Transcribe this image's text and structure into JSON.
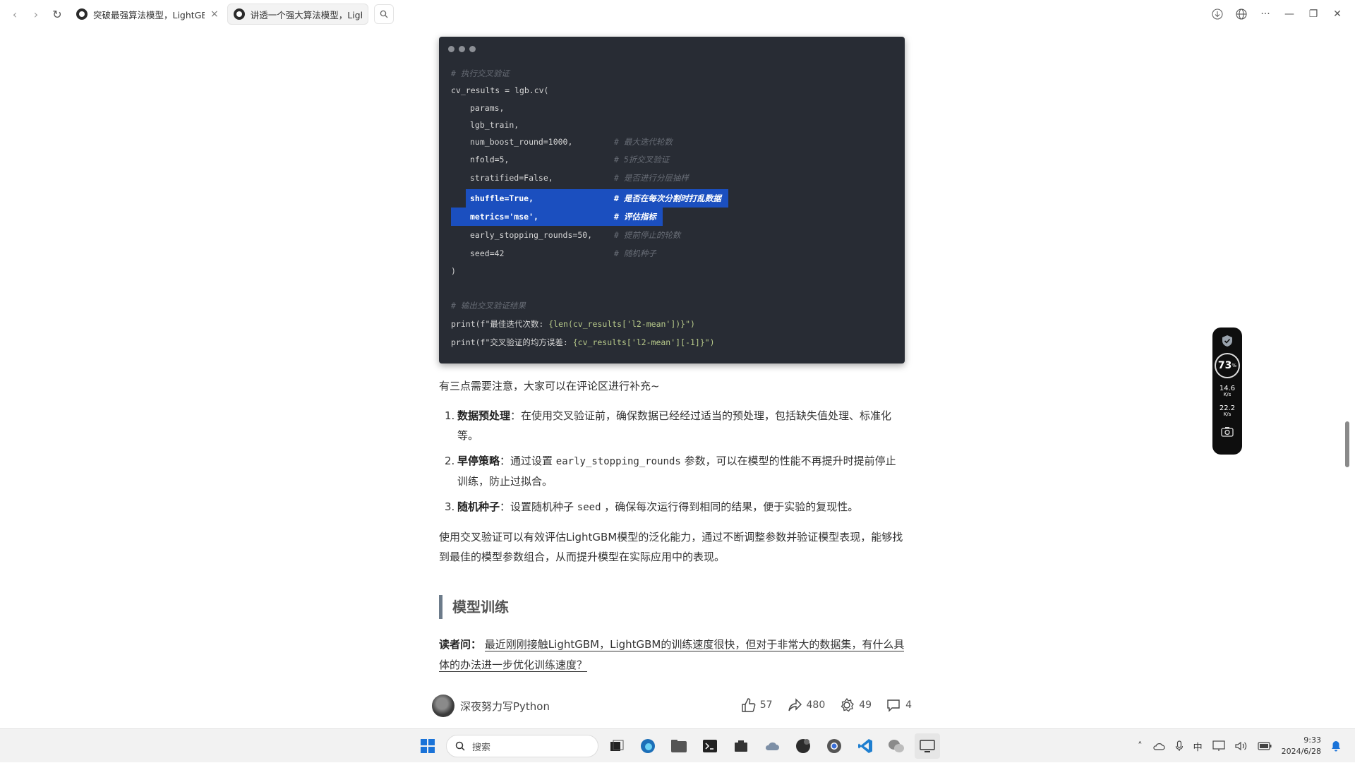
{
  "browser": {
    "tabs": [
      {
        "title": "突破最强算法模型，LightGBM",
        "active": false
      },
      {
        "title": "讲透一个强大算法模型，LightGBM",
        "active": true
      }
    ]
  },
  "code": {
    "comment_cv": "# 执行交叉验证",
    "l1": "cv_results = lgb.cv(",
    "l2": "params,",
    "l3": "lgb_train,",
    "l4": "num_boost_round=1000,",
    "c4": "# 最大迭代轮数",
    "l5": "nfold=5,",
    "c5": "# 5折交叉验证",
    "l6": "stratified=False,",
    "c6": "# 是否进行分层抽样",
    "l7": "shuffle=True,",
    "c7": "# 是否在每次分割时打乱数据",
    "l8": "metrics='mse',",
    "c8": "# 评估指标",
    "l9": "early_stopping_rounds=50,",
    "c9": "# 提前停止的轮数",
    "l10": "seed=42",
    "c10": "# 随机种子",
    "l11": ")",
    "comment_print": "# 输出交叉验证结果",
    "p1a": "print(f\"最佳迭代次数: ",
    "p1b": "{len(cv_results['l2-mean'])}\")",
    "p2a": "print(f\"交叉验证的均方误差: ",
    "p2b": "{cv_results['l2-mean'][-1]}\")"
  },
  "article": {
    "intro": "有三点需要注意，大家可以在评论区进行补充~",
    "items": [
      {
        "num": "1.",
        "title": "数据预处理",
        "text": "：在使用交叉验证前，确保数据已经经过适当的预处理，包括缺失值处理、标准化等。"
      },
      {
        "num": "2.",
        "title": "早停策略",
        "text_a": "：通过设置 ",
        "code": "early_stopping_rounds",
        "text_b": " 参数，可以在模型的性能不再提升时提前停止训练，防止过拟合。"
      },
      {
        "num": "3.",
        "title": "随机种子",
        "text_a": "：设置随机种子 ",
        "code": "seed",
        "text_b": " ，确保每次运行得到相同的结果，便于实验的复现性。"
      }
    ],
    "summary": "使用交叉验证可以有效评估LightGBM模型的泛化能力，通过不断调整参数并验证模型表现，能够找到最佳的模型参数组合，从而提升模型在实际应用中的表现。",
    "heading": "模型训练",
    "reader_label": "读者问：",
    "reader_question": "最近刚刚接触LightGBM，LightGBM的训练速度很快，但对于非常大的数据集，有什么具体的办法进一步优化训练速度？"
  },
  "footer": {
    "author": "深夜努力写Python",
    "likes": "57",
    "shares": "480",
    "favorites": "49",
    "comments": "4"
  },
  "widget": {
    "percent": "73",
    "percent_unit": "%",
    "up": "14.6",
    "up_unit": "K/s",
    "down": "22.2",
    "down_unit": "K/s"
  },
  "taskbar": {
    "search_placeholder": "搜索",
    "ime": "中",
    "time": "9:33",
    "date": "2024/6/28"
  }
}
